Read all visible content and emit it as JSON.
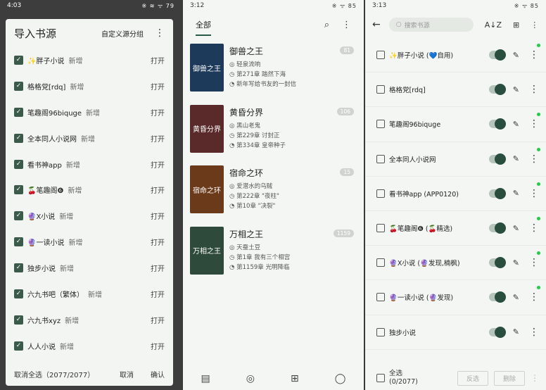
{
  "screen1": {
    "status": {
      "time": "4:03",
      "icons": "※ ≋ ᯤ 79"
    },
    "dialog": {
      "title": "导入书源",
      "custom_group": "自定义源分组",
      "menu": "⋮",
      "open_label": "打开",
      "items": [
        {
          "name": "✨胖子小说",
          "tag": "新增"
        },
        {
          "name": "格格党[rdq]",
          "tag": "新增"
        },
        {
          "name": "笔趣阁96biquge",
          "tag": "新增"
        },
        {
          "name": "全本同人小说网",
          "tag": "新增"
        },
        {
          "name": "看书神app",
          "tag": "新增"
        },
        {
          "name": "🍒笔趣阁❻",
          "tag": "新增"
        },
        {
          "name": "🔮X小说",
          "tag": "新增"
        },
        {
          "name": "🔮一读小说",
          "tag": "新增"
        },
        {
          "name": "独步小说",
          "tag": "新增"
        },
        {
          "name": "六九书吧（繁体）",
          "tag": "新增"
        },
        {
          "name": "六九书xyz",
          "tag": "新增"
        },
        {
          "name": "人人小说",
          "tag": "新增"
        }
      ],
      "footer": {
        "select": "取消全选（2077/2077）",
        "cancel": "取消",
        "confirm": "确认"
      }
    }
  },
  "screen2": {
    "status": {
      "time": "3:12",
      "icons": "※ ᯤ 85"
    },
    "tab": "全部",
    "books": [
      {
        "title": "御兽之王",
        "cover": "御兽之王",
        "author": "轻泉流响",
        "chapter": "第271章 踏然下海",
        "latest": "新年写给书友的一封信",
        "badge": "81",
        "color": "#1d3a5a"
      },
      {
        "title": "黄昏分界",
        "cover": "黄昏分界",
        "author": "黑山老鬼",
        "chapter": "第229章 讨封正",
        "latest": "第334章 皇帝种子",
        "badge": "106",
        "color": "#5a2a2a"
      },
      {
        "title": "宿命之环",
        "cover": "宿命之环",
        "author": "爱潜水的乌贼",
        "chapter": "第222章 \"夜柱\"",
        "latest": "第10章 \"决裂\"",
        "badge": "15",
        "color": "#6a3a1a"
      },
      {
        "title": "万相之王",
        "cover": "万相之王",
        "author": "天蚕土豆",
        "chapter": "第1章 我有三个相宫",
        "latest": "第1159章 光明降临",
        "badge": "1159",
        "color": "#2e4a3a"
      }
    ]
  },
  "screen3": {
    "status": {
      "time": "3:13",
      "icons": "※ ᯤ 85"
    },
    "search_placeholder": "搜索书源",
    "rows": [
      {
        "name": "✨胖子小说 (💙自用)",
        "dot": true
      },
      {
        "name": "格格党[rdq]",
        "dot": false
      },
      {
        "name": "笔趣阁96biquge",
        "dot": true
      },
      {
        "name": "全本同人小说网",
        "dot": true
      },
      {
        "name": "看书神app (APP0120)",
        "dot": true
      },
      {
        "name": "🍒笔趣阁❻ (🍒精选)",
        "dot": true
      },
      {
        "name": "🔮X小说 (🔮发现,楠枫)",
        "dot": true
      },
      {
        "name": "🔮一读小说 (🔮发现)",
        "dot": true
      },
      {
        "name": "独步小说",
        "dot": false
      }
    ],
    "footer": {
      "select_all": "全选",
      "count": "(0/2077)",
      "invert": "反选",
      "delete": "删除"
    }
  }
}
